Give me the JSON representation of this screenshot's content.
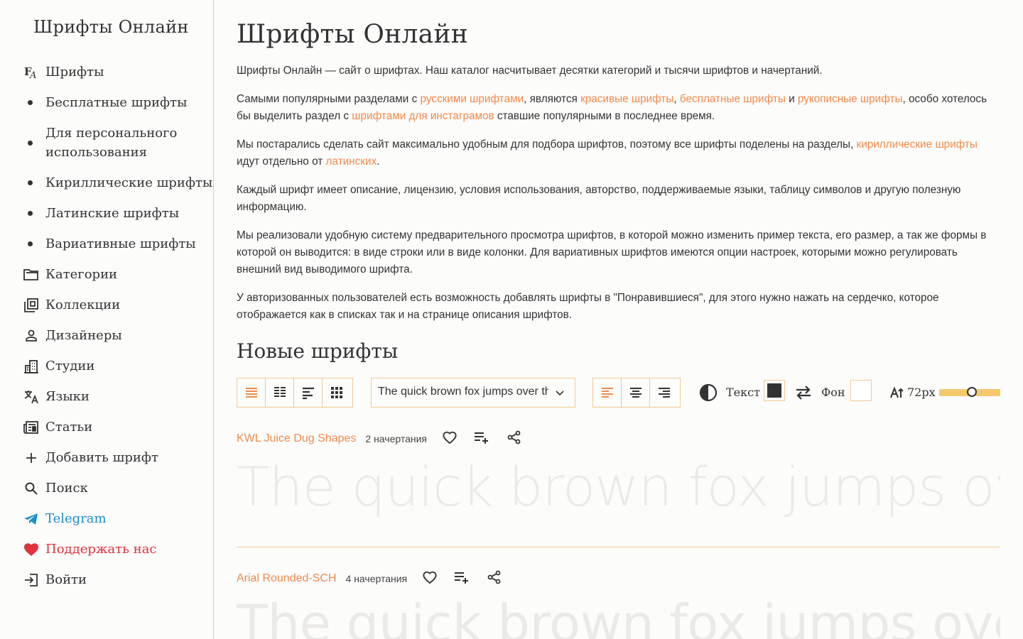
{
  "sidebar": {
    "logo": "Шрифты Онлайн",
    "items": [
      {
        "label": "Шрифты",
        "icon": "font-icon"
      },
      {
        "label": "Бесплатные шрифты",
        "icon": "bullet"
      },
      {
        "label": "Для персонального использования",
        "icon": "bullet"
      },
      {
        "label": "Кириллические шрифты",
        "icon": "bullet"
      },
      {
        "label": "Латинские шрифты",
        "icon": "bullet"
      },
      {
        "label": "Вариативные шрифты",
        "icon": "bullet"
      },
      {
        "label": "Категории",
        "icon": "folder-icon"
      },
      {
        "label": "Коллекции",
        "icon": "collection-icon"
      },
      {
        "label": "Дизайнеры",
        "icon": "person-icon"
      },
      {
        "label": "Студии",
        "icon": "building-icon"
      },
      {
        "label": "Языки",
        "icon": "translate-icon"
      },
      {
        "label": "Статьи",
        "icon": "newspaper-icon"
      },
      {
        "label": "Добавить шрифт",
        "icon": "plus-icon"
      },
      {
        "label": "Поиск",
        "icon": "search-icon"
      },
      {
        "label": "Telegram",
        "icon": "telegram-icon"
      },
      {
        "label": "Поддержать нас",
        "icon": "heart-icon"
      },
      {
        "label": "Войти",
        "icon": "login-icon"
      }
    ]
  },
  "main": {
    "title": "Шрифты Онлайн",
    "intro": "Шрифты Онлайн — сайт о шрифтах. Наш каталог насчитывает десятки категорий и тысячи шрифтов и начертаний.",
    "p2": {
      "t1": "Самыми популярными разделами с ",
      "l1": "русскими шрифтами",
      "t2": ", являются ",
      "l2": "красивые шрифты",
      "t3": ", ",
      "l3": "бесплатные шрифты",
      "t4": " и ",
      "l4": "рукописные шрифты",
      "t5": ", особо хотелось бы выделить раздел с ",
      "l5": "шрифтами для инстаграмов",
      "t6": " ставшие популярными в последнее время."
    },
    "p3": {
      "t1": "Мы постарались сделать сайт максимально удобным для подбора шрифтов, поэтому все шрифты поделены на разделы, ",
      "l1": "кириллические шрифты",
      "t2": " идут отдельно от ",
      "l2": "латинских",
      "t3": "."
    },
    "p4": "Каждый шрифт имеет описание, лицензию, условия использования, авторство, поддерживаемые языки, таблицу символов и другую полезную информацию.",
    "p5": "Мы реализовали удобную систему предварительного просмотра шрифтов, в которой можно изменить пример текста, его размер, а так же формы в которой он выводится: в виде строки или в виде колонки. Для вариативных шрифтов имеются опции настроек, которыми можно регулировать внешний вид выводимого шрифта.",
    "p6": "У авторизованных пользователей есть возможность добавлять шрифты в \"Понравившиеся\", для этого нужно нажать на сердечко, которое отображается как в списках так и на странице описания шрифтов.",
    "new_fonts_heading": "Новые шрифты"
  },
  "toolbar": {
    "sample_text": "The quick brown fox jumps over th",
    "text_label": "Текст",
    "bg_label": "Фон",
    "size_label": "72px",
    "text_color": "#333333",
    "bg_color": "#ffffff",
    "accent": "#f08a4b",
    "size_level_percent": 54
  },
  "fonts": [
    {
      "name": "KWL Juice Dug Shapes",
      "styles": "2 начертания",
      "preview": "The quick brown fox jumps over th"
    },
    {
      "name": "Arial Rounded-SCH",
      "styles": "4 начертания",
      "preview": "The quick brown fox jumps over th"
    }
  ]
}
